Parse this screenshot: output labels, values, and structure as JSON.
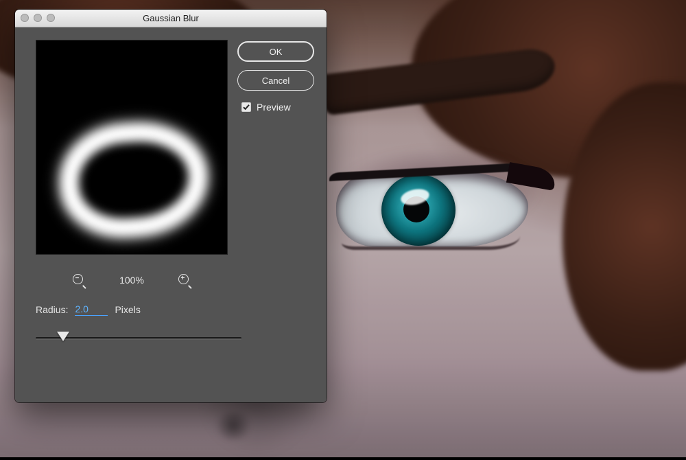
{
  "dialog": {
    "title": "Gaussian Blur",
    "zoom_pct": "100%",
    "radius_label": "Radius:",
    "radius_value": "2.0",
    "radius_unit": "Pixels",
    "ok_label": "OK",
    "cancel_label": "Cancel",
    "preview_label": "Preview",
    "preview_checked": true,
    "slider_value": 2.0,
    "slider_min": 0.1,
    "slider_max": 1000
  }
}
